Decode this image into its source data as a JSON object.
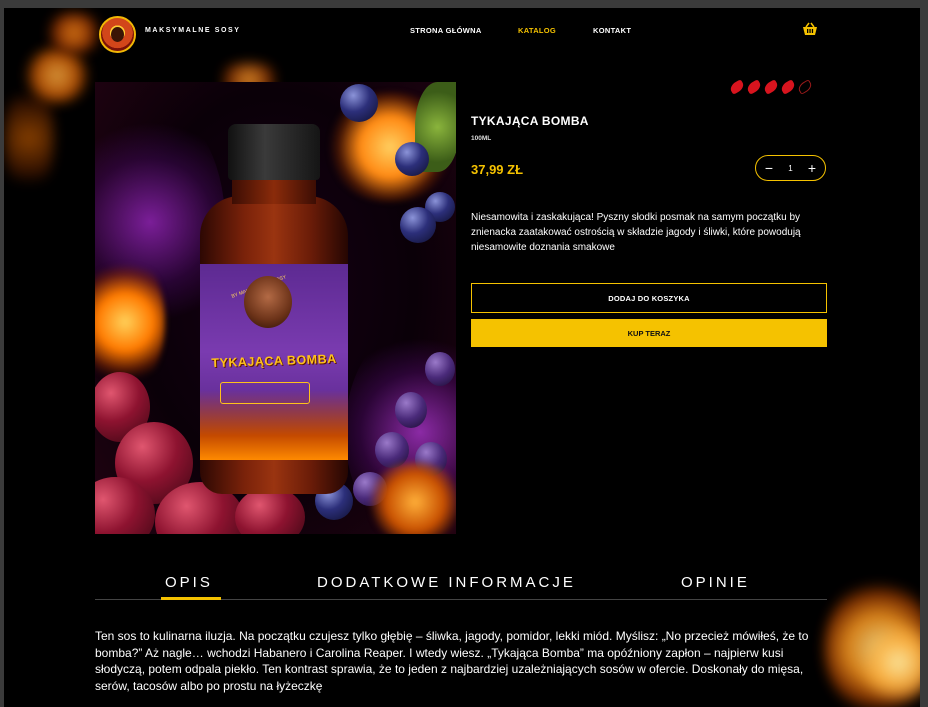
{
  "header": {
    "brand": "MAKSYMALNE SOSY",
    "nav": [
      "STRONA GŁÓWNA",
      "KATALOG",
      "KONTAKT"
    ],
    "active_nav": "KATALOG"
  },
  "product": {
    "heat_rating": 4,
    "heat_max": 5,
    "name": "TYKAJĄCA BOMBA",
    "volume": "100ML",
    "price": "37,99 ZŁ",
    "quantity": "1",
    "qty_minus": "−",
    "qty_plus": "+",
    "description": "Niesamowita i zaskakująca! Pyszny słodki posmak na samym początku by znienacka zaatakować ostrością w składzie jagody i śliwki, które powodują niesamowite doznania smakowe",
    "add_to_cart": "DODAJ DO KOSZYKA",
    "buy_now": "KUP TERAZ",
    "bottle_label": "TYKAJĄCA BOMBA",
    "bottle_sub": "BY MAKSYMALNE SOSY"
  },
  "tabs": {
    "items": [
      "OPIS",
      "DODATKOWE INFORMACJE",
      "OPINIE"
    ],
    "active": "OPIS"
  },
  "content": {
    "description": "Ten sos to kulinarna iluzja. Na początku czujesz tylko głębię – śliwka, jagody, pomidor, lekki miód. Myślisz: „No przecież mówiłeś, że to bomba?” Aż nagle… wchodzi Habanero i Carolina Reaper. I wtedy wiesz. „Tykająca Bomba” ma opóźniony zapłon – najpierw kusi słodyczą, potem odpala piekło. Ten kontrast sprawia, że to jeden z najbardziej uzależniających sosów w ofercie. Doskonały do mięsa, serów, tacosów albo po prostu na łyżeczkę"
  },
  "colors": {
    "accent": "#f5c200",
    "pepper": "#d8141e",
    "background": "#000000"
  },
  "icons": {
    "cart": "basket-icon",
    "rating": "chili-pepper-icon"
  }
}
